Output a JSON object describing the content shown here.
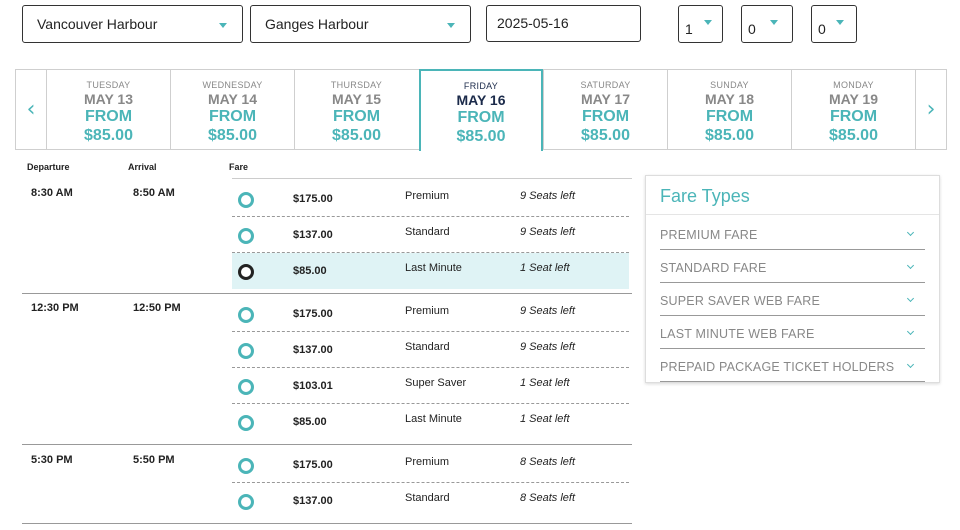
{
  "search": {
    "departure": "Vancouver Harbour",
    "arrival": "Ganges Harbour",
    "date": "2025-05-16",
    "pax": [
      "1",
      "0",
      "0"
    ]
  },
  "carousel": {
    "prev": "‹",
    "next": "›",
    "days": [
      {
        "dow": "TUESDAY",
        "date": "MAY 13",
        "from": "FROM",
        "price": "$85.00",
        "active": false
      },
      {
        "dow": "WEDNESDAY",
        "date": "MAY 14",
        "from": "FROM",
        "price": "$85.00",
        "active": false
      },
      {
        "dow": "THURSDAY",
        "date": "MAY 15",
        "from": "FROM",
        "price": "$85.00",
        "active": false
      },
      {
        "dow": "FRIDAY",
        "date": "MAY 16",
        "from": "FROM",
        "price": "$85.00",
        "active": true
      },
      {
        "dow": "SATURDAY",
        "date": "MAY 17",
        "from": "FROM",
        "price": "$85.00",
        "active": false
      },
      {
        "dow": "SUNDAY",
        "date": "MAY 18",
        "from": "FROM",
        "price": "$85.00",
        "active": false
      },
      {
        "dow": "MONDAY",
        "date": "MAY 19",
        "from": "FROM",
        "price": "$85.00",
        "active": false
      }
    ]
  },
  "schedule": {
    "headers": {
      "departure": "Departure",
      "arrival": "Arrival",
      "fare": "Fare"
    },
    "sailings": [
      {
        "departure": "8:30 AM",
        "arrival": "8:50 AM",
        "fares": [
          {
            "price": "$175.00",
            "type": "Premium",
            "seats": "9 Seats left",
            "selected": false
          },
          {
            "price": "$137.00",
            "type": "Standard",
            "seats": "9 Seats left",
            "selected": false
          },
          {
            "price": "$85.00",
            "type": "Last Minute",
            "seats": "1 Seat left",
            "selected": true
          }
        ]
      },
      {
        "departure": "12:30 PM",
        "arrival": "12:50 PM",
        "fares": [
          {
            "price": "$175.00",
            "type": "Premium",
            "seats": "9 Seats left",
            "selected": false
          },
          {
            "price": "$137.00",
            "type": "Standard",
            "seats": "9 Seats left",
            "selected": false
          },
          {
            "price": "$103.01",
            "type": "Super Saver",
            "seats": "1 Seat left",
            "selected": false
          },
          {
            "price": "$85.00",
            "type": "Last Minute",
            "seats": "1 Seat left",
            "selected": false
          }
        ]
      },
      {
        "departure": "5:30 PM",
        "arrival": "5:50 PM",
        "fares": [
          {
            "price": "$175.00",
            "type": "Premium",
            "seats": "8 Seats left",
            "selected": false
          },
          {
            "price": "$137.00",
            "type": "Standard",
            "seats": "8 Seats left",
            "selected": false
          }
        ]
      }
    ]
  },
  "fare_types": {
    "title": "Fare Types",
    "items": [
      "PREMIUM FARE",
      "STANDARD FARE",
      "SUPER SAVER WEB FARE",
      "LAST MINUTE WEB FARE",
      "PREPAID PACKAGE TICKET HOLDERS"
    ]
  },
  "colors": {
    "accent": "#4bb5b8",
    "selected_row": "#dff3f5",
    "active_text": "#1b2a4a"
  }
}
